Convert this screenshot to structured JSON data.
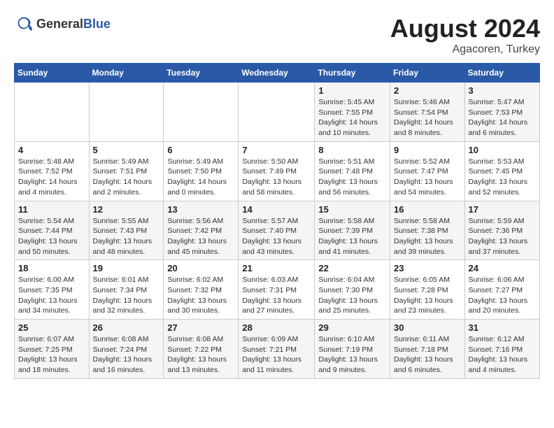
{
  "header": {
    "logo_general": "General",
    "logo_blue": "Blue",
    "month_title": "August 2024",
    "subtitle": "Agacoren, Turkey"
  },
  "weekdays": [
    "Sunday",
    "Monday",
    "Tuesday",
    "Wednesday",
    "Thursday",
    "Friday",
    "Saturday"
  ],
  "weeks": [
    [
      {
        "day": "",
        "info": ""
      },
      {
        "day": "",
        "info": ""
      },
      {
        "day": "",
        "info": ""
      },
      {
        "day": "",
        "info": ""
      },
      {
        "day": "1",
        "info": "Sunrise: 5:45 AM\nSunset: 7:55 PM\nDaylight: 14 hours\nand 10 minutes."
      },
      {
        "day": "2",
        "info": "Sunrise: 5:46 AM\nSunset: 7:54 PM\nDaylight: 14 hours\nand 8 minutes."
      },
      {
        "day": "3",
        "info": "Sunrise: 5:47 AM\nSunset: 7:53 PM\nDaylight: 14 hours\nand 6 minutes."
      }
    ],
    [
      {
        "day": "4",
        "info": "Sunrise: 5:48 AM\nSunset: 7:52 PM\nDaylight: 14 hours\nand 4 minutes."
      },
      {
        "day": "5",
        "info": "Sunrise: 5:49 AM\nSunset: 7:51 PM\nDaylight: 14 hours\nand 2 minutes."
      },
      {
        "day": "6",
        "info": "Sunrise: 5:49 AM\nSunset: 7:50 PM\nDaylight: 14 hours\nand 0 minutes."
      },
      {
        "day": "7",
        "info": "Sunrise: 5:50 AM\nSunset: 7:49 PM\nDaylight: 13 hours\nand 58 minutes."
      },
      {
        "day": "8",
        "info": "Sunrise: 5:51 AM\nSunset: 7:48 PM\nDaylight: 13 hours\nand 56 minutes."
      },
      {
        "day": "9",
        "info": "Sunrise: 5:52 AM\nSunset: 7:47 PM\nDaylight: 13 hours\nand 54 minutes."
      },
      {
        "day": "10",
        "info": "Sunrise: 5:53 AM\nSunset: 7:45 PM\nDaylight: 13 hours\nand 52 minutes."
      }
    ],
    [
      {
        "day": "11",
        "info": "Sunrise: 5:54 AM\nSunset: 7:44 PM\nDaylight: 13 hours\nand 50 minutes."
      },
      {
        "day": "12",
        "info": "Sunrise: 5:55 AM\nSunset: 7:43 PM\nDaylight: 13 hours\nand 48 minutes."
      },
      {
        "day": "13",
        "info": "Sunrise: 5:56 AM\nSunset: 7:42 PM\nDaylight: 13 hours\nand 45 minutes."
      },
      {
        "day": "14",
        "info": "Sunrise: 5:57 AM\nSunset: 7:40 PM\nDaylight: 13 hours\nand 43 minutes."
      },
      {
        "day": "15",
        "info": "Sunrise: 5:58 AM\nSunset: 7:39 PM\nDaylight: 13 hours\nand 41 minutes."
      },
      {
        "day": "16",
        "info": "Sunrise: 5:58 AM\nSunset: 7:38 PM\nDaylight: 13 hours\nand 39 minutes."
      },
      {
        "day": "17",
        "info": "Sunrise: 5:59 AM\nSunset: 7:36 PM\nDaylight: 13 hours\nand 37 minutes."
      }
    ],
    [
      {
        "day": "18",
        "info": "Sunrise: 6:00 AM\nSunset: 7:35 PM\nDaylight: 13 hours\nand 34 minutes."
      },
      {
        "day": "19",
        "info": "Sunrise: 6:01 AM\nSunset: 7:34 PM\nDaylight: 13 hours\nand 32 minutes."
      },
      {
        "day": "20",
        "info": "Sunrise: 6:02 AM\nSunset: 7:32 PM\nDaylight: 13 hours\nand 30 minutes."
      },
      {
        "day": "21",
        "info": "Sunrise: 6:03 AM\nSunset: 7:31 PM\nDaylight: 13 hours\nand 27 minutes."
      },
      {
        "day": "22",
        "info": "Sunrise: 6:04 AM\nSunset: 7:30 PM\nDaylight: 13 hours\nand 25 minutes."
      },
      {
        "day": "23",
        "info": "Sunrise: 6:05 AM\nSunset: 7:28 PM\nDaylight: 13 hours\nand 23 minutes."
      },
      {
        "day": "24",
        "info": "Sunrise: 6:06 AM\nSunset: 7:27 PM\nDaylight: 13 hours\nand 20 minutes."
      }
    ],
    [
      {
        "day": "25",
        "info": "Sunrise: 6:07 AM\nSunset: 7:25 PM\nDaylight: 13 hours\nand 18 minutes."
      },
      {
        "day": "26",
        "info": "Sunrise: 6:08 AM\nSunset: 7:24 PM\nDaylight: 13 hours\nand 16 minutes."
      },
      {
        "day": "27",
        "info": "Sunrise: 6:08 AM\nSunset: 7:22 PM\nDaylight: 13 hours\nand 13 minutes."
      },
      {
        "day": "28",
        "info": "Sunrise: 6:09 AM\nSunset: 7:21 PM\nDaylight: 13 hours\nand 11 minutes."
      },
      {
        "day": "29",
        "info": "Sunrise: 6:10 AM\nSunset: 7:19 PM\nDaylight: 13 hours\nand 9 minutes."
      },
      {
        "day": "30",
        "info": "Sunrise: 6:11 AM\nSunset: 7:18 PM\nDaylight: 13 hours\nand 6 minutes."
      },
      {
        "day": "31",
        "info": "Sunrise: 6:12 AM\nSunset: 7:16 PM\nDaylight: 13 hours\nand 4 minutes."
      }
    ]
  ]
}
